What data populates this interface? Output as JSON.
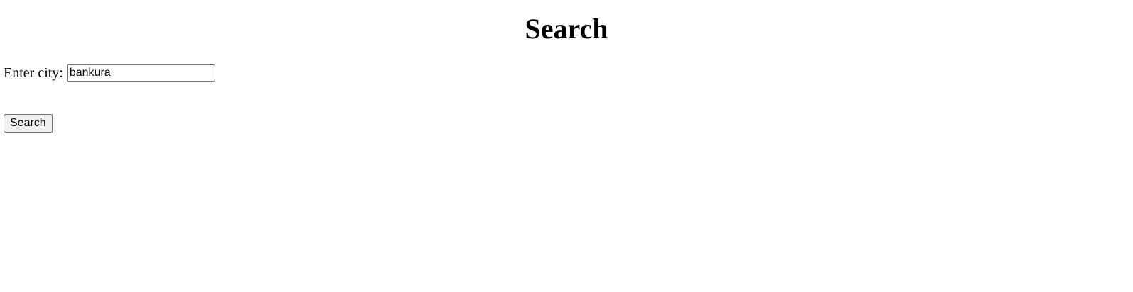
{
  "page": {
    "title": "Search"
  },
  "form": {
    "city_label": "Enter city:",
    "city_value": "bankura",
    "submit_label": "Search"
  }
}
